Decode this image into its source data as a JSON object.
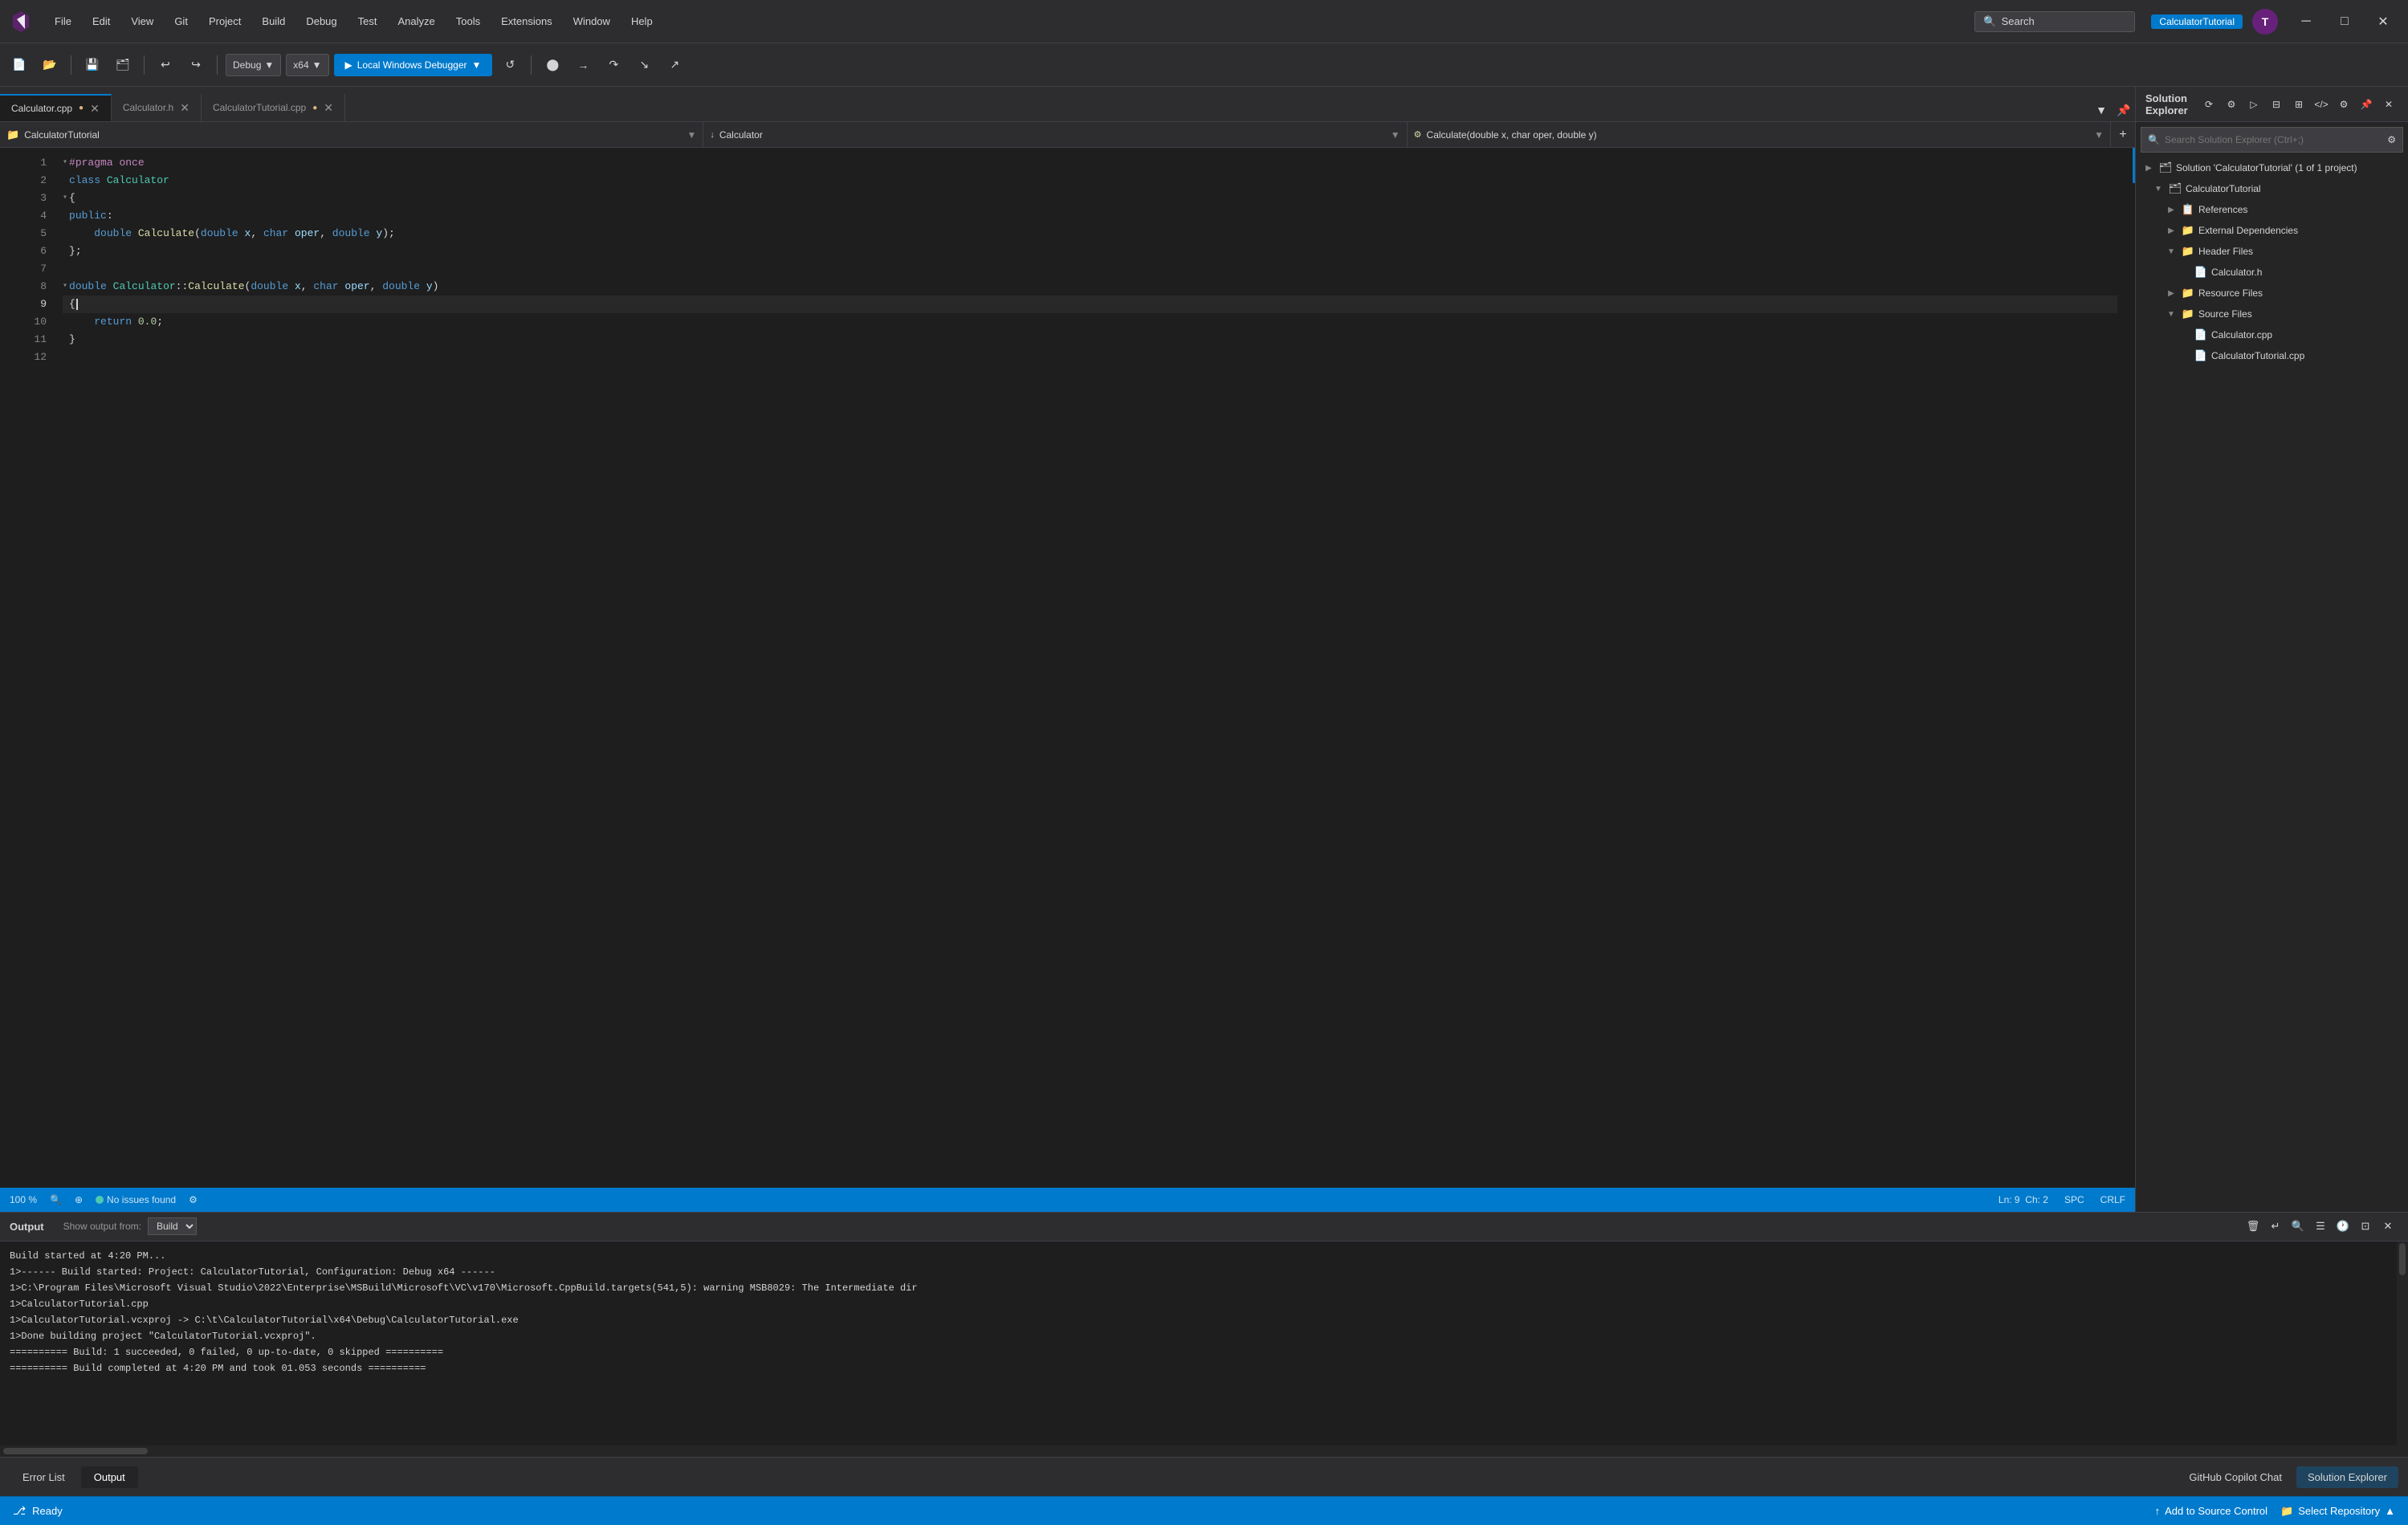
{
  "titleBar": {
    "menus": [
      "File",
      "Edit",
      "View",
      "Git",
      "Project",
      "Build",
      "Debug",
      "Test",
      "Analyze",
      "Tools",
      "Extensions",
      "Window",
      "Help"
    ],
    "searchLabel": "Search",
    "projectBadge": "CalculatorTutorial",
    "windowControls": [
      "─",
      "□",
      "✕"
    ]
  },
  "toolbar": {
    "debugConfig": "Debug",
    "platform": "x64",
    "runLabel": "Local Windows Debugger"
  },
  "editorTabs": [
    {
      "name": "Calculator.cpp",
      "active": true,
      "modified": true
    },
    {
      "name": "Calculator.h",
      "active": false,
      "modified": false
    },
    {
      "name": "CalculatorTutorial.cpp",
      "active": false,
      "modified": true
    }
  ],
  "navBar": {
    "project": "CalculatorTutorial",
    "class": "Calculator",
    "method": "Calculate(double x, char oper, double y)"
  },
  "code": {
    "lines": [
      {
        "num": 1,
        "text": "#pragma once",
        "tokens": [
          {
            "t": "#pragma once",
            "c": "pp"
          }
        ]
      },
      {
        "num": 2,
        "text": "class Calculator",
        "tokens": [
          {
            "t": "class ",
            "c": "kw"
          },
          {
            "t": "Calculator",
            "c": "type"
          }
        ]
      },
      {
        "num": 3,
        "text": "{",
        "tokens": [
          {
            "t": "{",
            "c": "plain"
          }
        ]
      },
      {
        "num": 4,
        "text": "public:",
        "tokens": [
          {
            "t": "public",
            "c": "kw"
          },
          {
            "t": ":",
            "c": "plain"
          }
        ]
      },
      {
        "num": 5,
        "text": "    double Calculate(double x, char oper, double y);",
        "tokens": [
          {
            "t": "    ",
            "c": "plain"
          },
          {
            "t": "double",
            "c": "kw"
          },
          {
            "t": " Calculate",
            "c": "fn"
          },
          {
            "t": "(",
            "c": "plain"
          },
          {
            "t": "double",
            "c": "kw"
          },
          {
            "t": " x, ",
            "c": "param"
          },
          {
            "t": "char",
            "c": "kw"
          },
          {
            "t": " oper, ",
            "c": "param"
          },
          {
            "t": "double",
            "c": "kw"
          },
          {
            "t": " y",
            "c": "param"
          },
          {
            "t": ");",
            "c": "plain"
          }
        ]
      },
      {
        "num": 6,
        "text": "};",
        "tokens": [
          {
            "t": "};",
            "c": "plain"
          }
        ]
      },
      {
        "num": 7,
        "text": "",
        "tokens": []
      },
      {
        "num": 8,
        "text": "double Calculator::Calculate(double x, char oper, double y)",
        "tokens": [
          {
            "t": "double",
            "c": "kw"
          },
          {
            "t": " Calculator",
            "c": "type"
          },
          {
            "t": "::",
            "c": "plain"
          },
          {
            "t": "Calculate",
            "c": "fn"
          },
          {
            "t": "(",
            "c": "plain"
          },
          {
            "t": "double",
            "c": "kw"
          },
          {
            "t": " x, ",
            "c": "param"
          },
          {
            "t": "char",
            "c": "kw"
          },
          {
            "t": " oper, ",
            "c": "param"
          },
          {
            "t": "double",
            "c": "kw"
          },
          {
            "t": " y",
            "c": "param"
          },
          {
            "t": ")",
            "c": "plain"
          }
        ]
      },
      {
        "num": 9,
        "text": "{",
        "tokens": [
          {
            "t": "{",
            "c": "plain"
          }
        ],
        "active": true
      },
      {
        "num": 10,
        "text": "    return 0.0;",
        "tokens": [
          {
            "t": "    ",
            "c": "plain"
          },
          {
            "t": "return",
            "c": "kw"
          },
          {
            "t": " ",
            "c": "plain"
          },
          {
            "t": "0.0",
            "c": "num"
          },
          {
            "t": ";",
            "c": "plain"
          }
        ]
      },
      {
        "num": 11,
        "text": "}",
        "tokens": [
          {
            "t": "}",
            "c": "plain"
          }
        ]
      },
      {
        "num": 12,
        "text": "",
        "tokens": []
      }
    ]
  },
  "statusBar": {
    "zoom": "100 %",
    "issues": "No issues found",
    "line": "Ln: 9",
    "col": "Ch: 2",
    "encoding": "SPC",
    "lineEnding": "CRLF"
  },
  "outputPanel": {
    "title": "Output",
    "showOutputFrom": "Show output from:",
    "buildLabel": "Build",
    "lines": [
      "Build started at 4:20 PM...",
      "1>------ Build started: Project: CalculatorTutorial, Configuration: Debug x64 ------",
      "1>C:\\Program Files\\Microsoft Visual Studio\\2022\\Enterprise\\MSBuild\\Microsoft\\VC\\v170\\Microsoft.CppBuild.targets(541,5): warning MSB8029: The Intermediate dir",
      "1>CalculatorTutorial.cpp",
      "1>CalculatorTutorial.vcxproj -> C:\\t\\CalculatorTutorial\\x64\\Debug\\CalculatorTutorial.exe",
      "1>Done building project \"CalculatorTutorial.vcxproj\".",
      "========== Build: 1 succeeded, 0 failed, 0 up-to-date, 0 skipped ==========",
      "========== Build completed at 4:20 PM and took 01.053 seconds =========="
    ]
  },
  "bottomTabs": [
    {
      "label": "Error List",
      "active": false
    },
    {
      "label": "Output",
      "active": true
    }
  ],
  "bottomRight": {
    "copilotChat": "GitHub Copilot Chat",
    "solutionExplorer": "Solution Explorer",
    "addToSourceControl": "Add to Source Control",
    "selectRepository": "Select Repository"
  },
  "solutionExplorer": {
    "title": "Solution Explorer",
    "searchPlaceholder": "Search Solution Explorer (Ctrl+;)",
    "tree": {
      "solution": "Solution 'CalculatorTutorial' (1 of 1 project)",
      "project": "CalculatorTutorial",
      "nodes": [
        {
          "label": "References",
          "indent": 2,
          "icon": "📋",
          "expanded": false
        },
        {
          "label": "External Dependencies",
          "indent": 2,
          "icon": "📁",
          "expanded": false
        },
        {
          "label": "Header Files",
          "indent": 2,
          "icon": "📁",
          "expanded": true
        },
        {
          "label": "Calculator.h",
          "indent": 3,
          "icon": "📄",
          "isFile": true
        },
        {
          "label": "Resource Files",
          "indent": 2,
          "icon": "📁",
          "expanded": false
        },
        {
          "label": "Source Files",
          "indent": 2,
          "icon": "📁",
          "expanded": true
        },
        {
          "label": "Calculator.cpp",
          "indent": 3,
          "icon": "📄",
          "isFile": true
        },
        {
          "label": "CalculatorTutorial.cpp",
          "indent": 3,
          "icon": "📄",
          "isFile": true
        }
      ]
    }
  },
  "statusStrip": {
    "ready": "Ready"
  }
}
